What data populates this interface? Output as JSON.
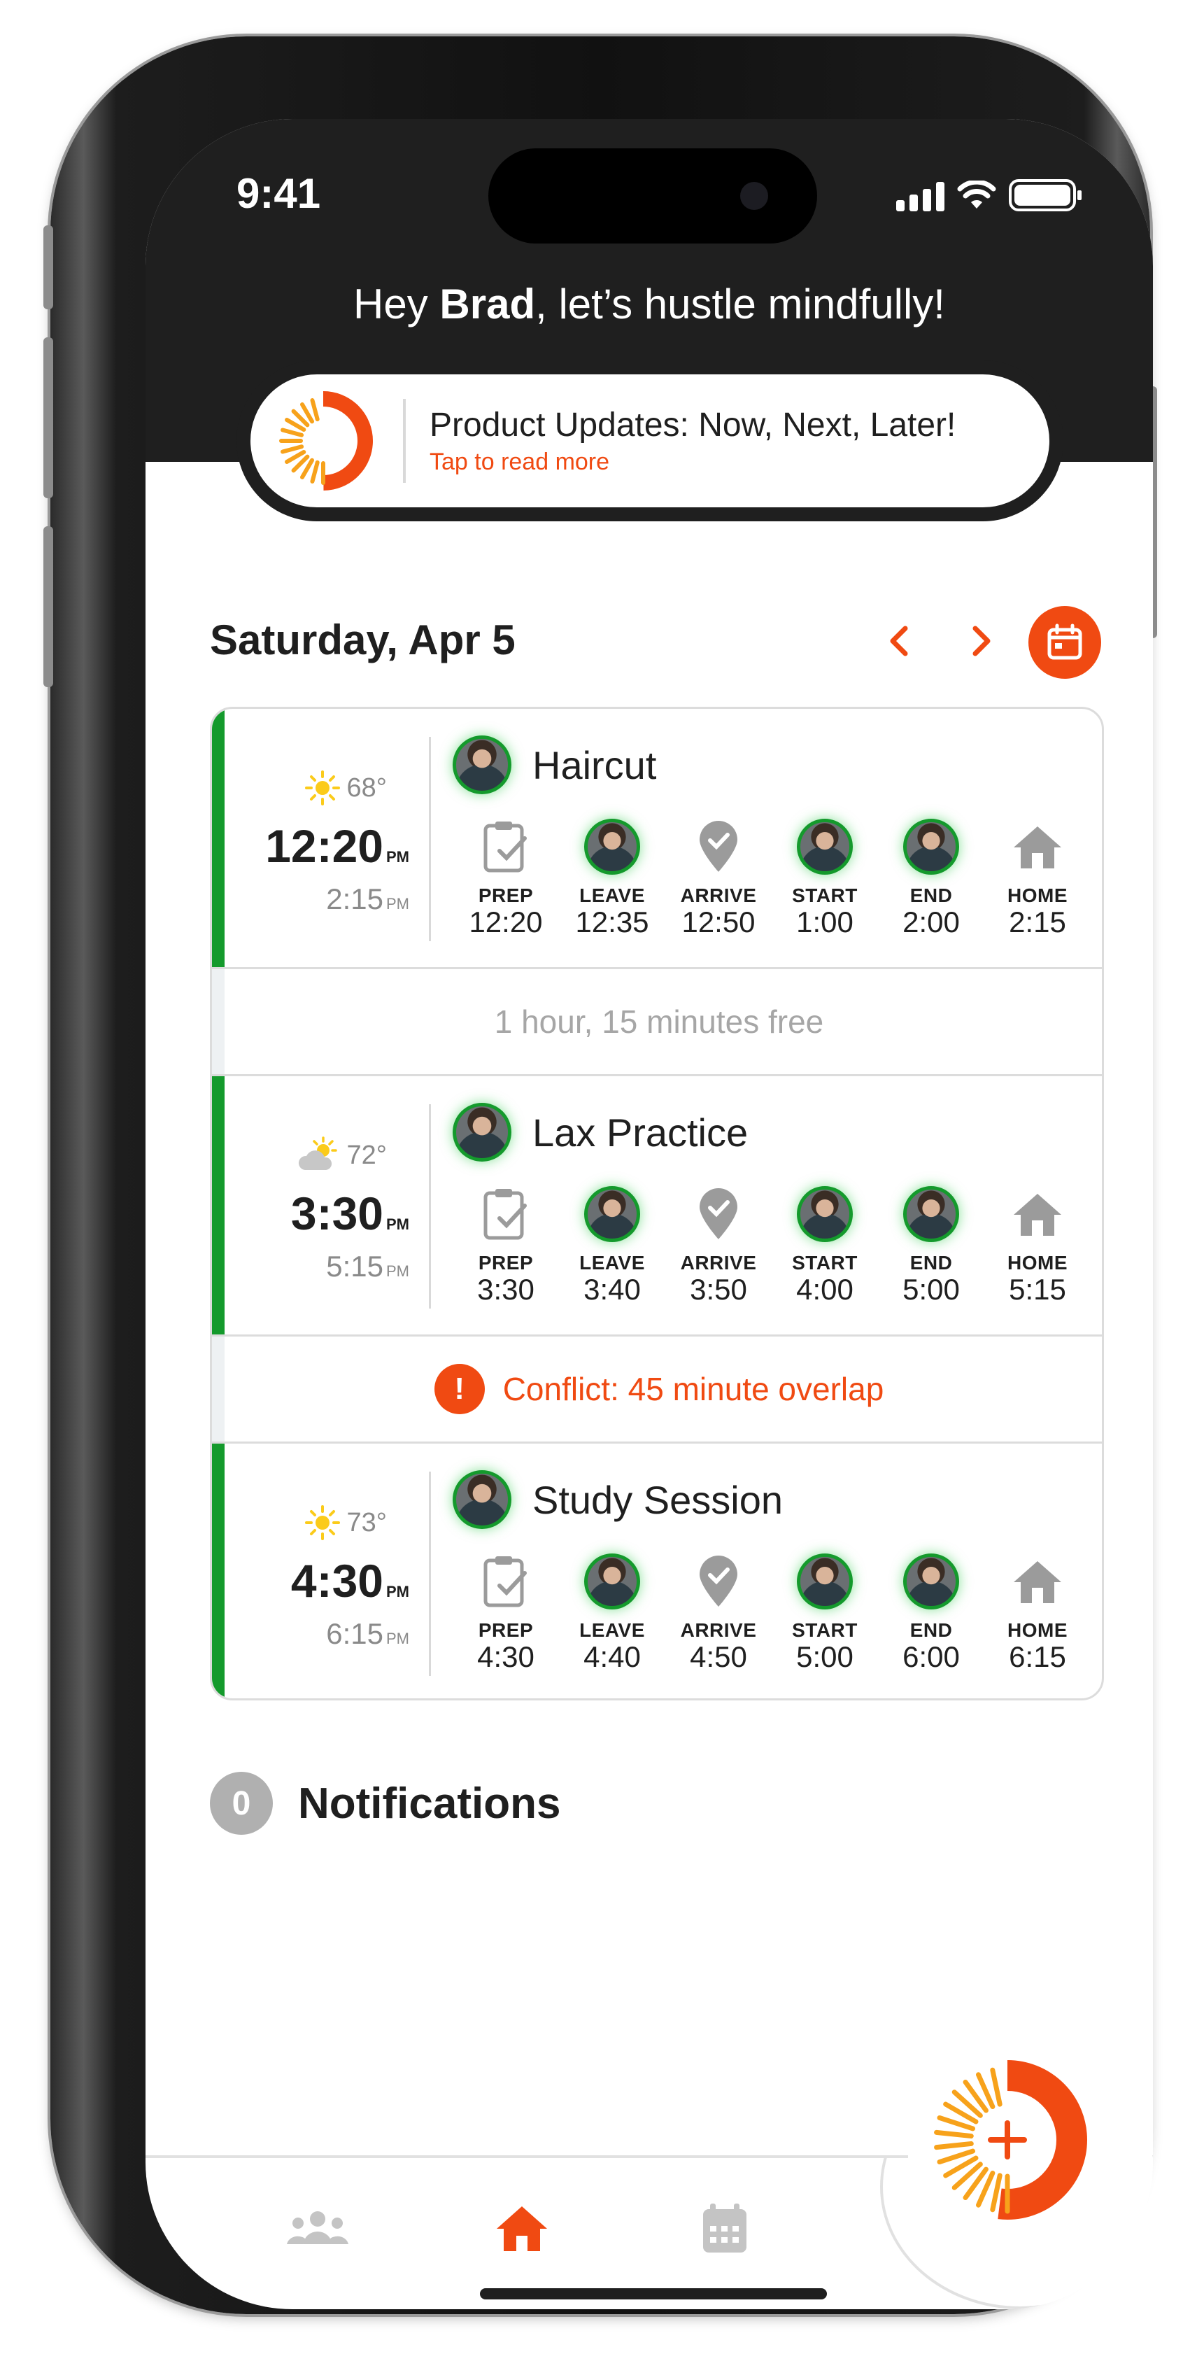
{
  "status_bar": {
    "time": "9:41"
  },
  "header": {
    "greeting_prefix": "Hey ",
    "user_name": "Brad",
    "greeting_suffix": ", let’s hustle mindfully!"
  },
  "update_banner": {
    "title": "Product Updates: Now, Next, Later!",
    "subtitle": "Tap to read more"
  },
  "date_nav": {
    "date": "Saturday, Apr 5",
    "prev_icon": "chevron-left-icon",
    "next_icon": "chevron-right-icon",
    "calendar_icon": "calendar-icon"
  },
  "colors": {
    "accent": "#f04a12",
    "success": "#149a2c",
    "header_bg": "#1f1f1f",
    "muted": "#a6a6a6"
  },
  "events": [
    {
      "title": "Haircut",
      "temp": "68°",
      "weather_icon": "sun-icon",
      "start": "12:20",
      "start_ampm": "PM",
      "end": "2:15",
      "end_ampm": "PM",
      "steps": [
        {
          "label": "PREP",
          "time": "12:20",
          "icon": "clipboard-check-icon"
        },
        {
          "label": "LEAVE",
          "time": "12:35",
          "icon": "avatar"
        },
        {
          "label": "ARRIVE",
          "time": "12:50",
          "icon": "location-check-icon"
        },
        {
          "label": "START",
          "time": "1:00",
          "icon": "avatar"
        },
        {
          "label": "END",
          "time": "2:00",
          "icon": "avatar"
        },
        {
          "label": "HOME",
          "time": "2:15",
          "icon": "home-icon"
        }
      ]
    },
    {
      "title": "Lax Practice",
      "temp": "72°",
      "weather_icon": "partly-cloudy-icon",
      "start": "3:30",
      "start_ampm": "PM",
      "end": "5:15",
      "end_ampm": "PM",
      "steps": [
        {
          "label": "PREP",
          "time": "3:30",
          "icon": "clipboard-check-icon"
        },
        {
          "label": "LEAVE",
          "time": "3:40",
          "icon": "avatar"
        },
        {
          "label": "ARRIVE",
          "time": "3:50",
          "icon": "location-check-icon"
        },
        {
          "label": "START",
          "time": "4:00",
          "icon": "avatar"
        },
        {
          "label": "END",
          "time": "5:00",
          "icon": "avatar"
        },
        {
          "label": "HOME",
          "time": "5:15",
          "icon": "home-icon"
        }
      ]
    },
    {
      "title": "Study Session",
      "temp": "73°",
      "weather_icon": "sun-icon",
      "start": "4:30",
      "start_ampm": "PM",
      "end": "6:15",
      "end_ampm": "PM",
      "steps": [
        {
          "label": "PREP",
          "time": "4:30",
          "icon": "clipboard-check-icon"
        },
        {
          "label": "LEAVE",
          "time": "4:40",
          "icon": "avatar"
        },
        {
          "label": "ARRIVE",
          "time": "4:50",
          "icon": "location-check-icon"
        },
        {
          "label": "START",
          "time": "5:00",
          "icon": "avatar"
        },
        {
          "label": "END",
          "time": "6:00",
          "icon": "avatar"
        },
        {
          "label": "HOME",
          "time": "6:15",
          "icon": "home-icon"
        }
      ]
    }
  ],
  "gaps": {
    "free_time": "1 hour, 15 minutes free",
    "conflict_mark": "!",
    "conflict": "Conflict: 45 minute overlap"
  },
  "notifications": {
    "count": "0",
    "title": "Notifications"
  },
  "tabbar": {
    "tabs": [
      {
        "name": "people-icon",
        "active": false
      },
      {
        "name": "home-icon",
        "active": true
      },
      {
        "name": "calendar-grid-icon",
        "active": false
      }
    ],
    "fab_icon": "plus-icon"
  }
}
